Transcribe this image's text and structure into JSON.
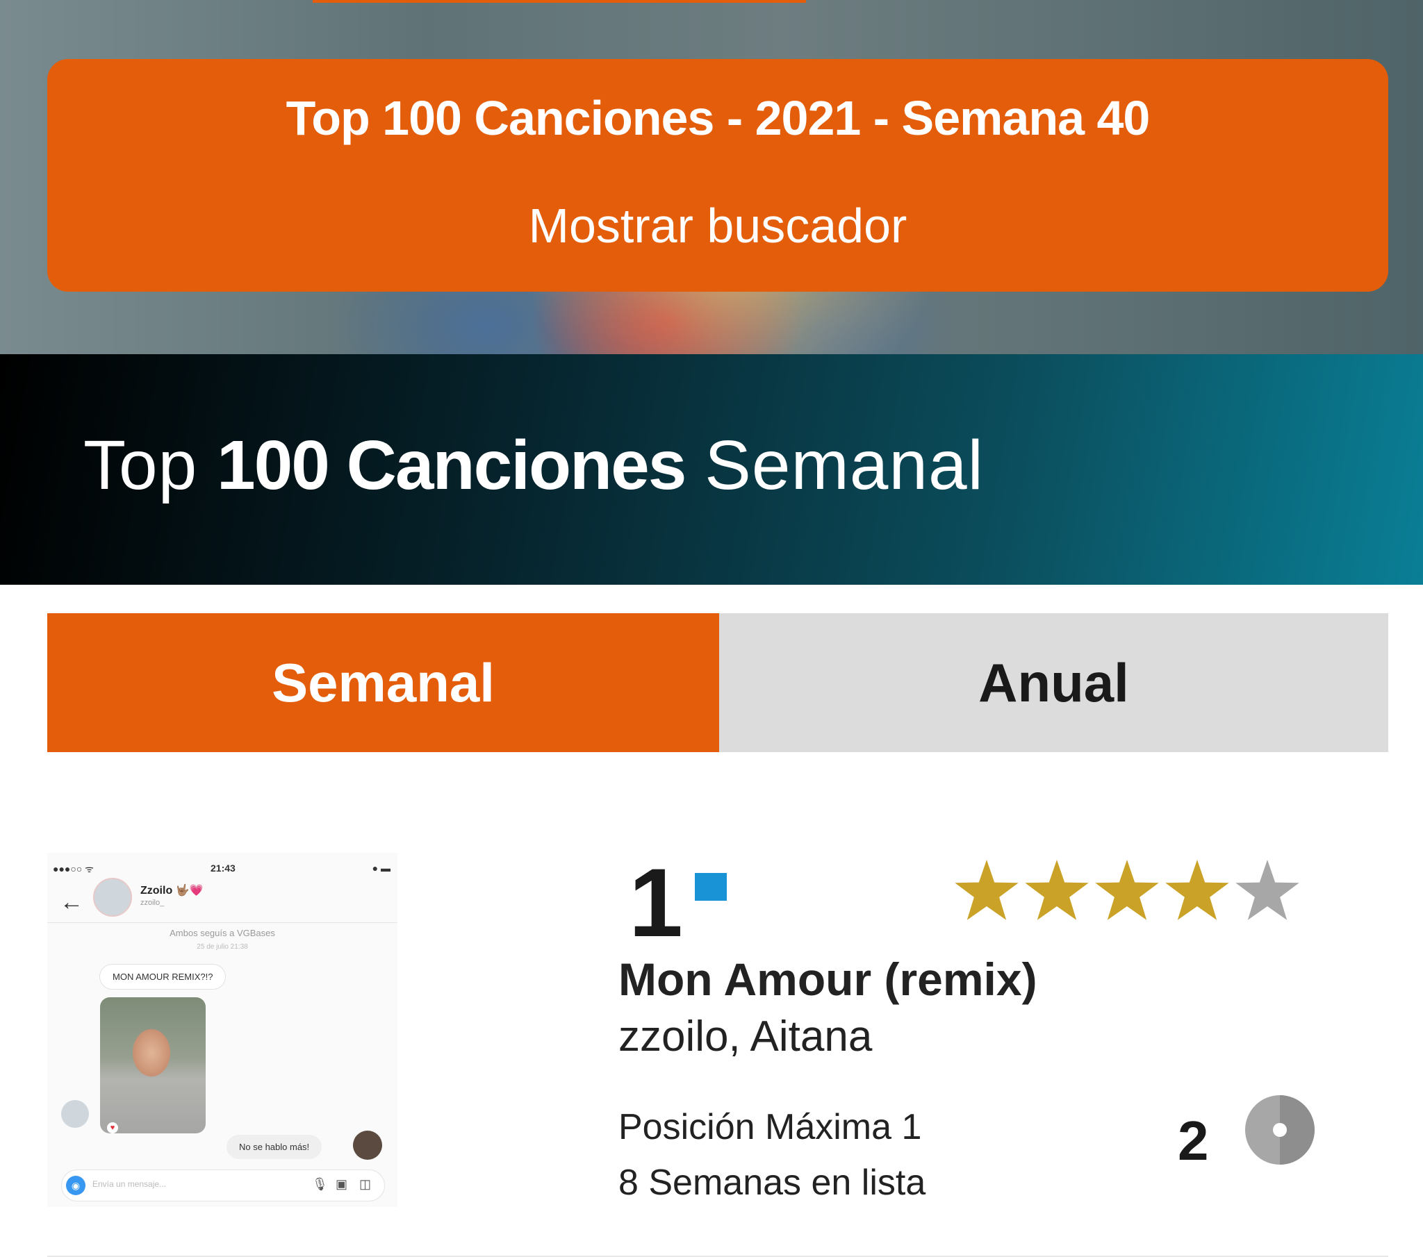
{
  "banner": {
    "title": "Top 100 Canciones - 2021 - Semana 40",
    "search_toggle": "Mostrar buscador"
  },
  "section": {
    "heading_prefix": "Top",
    "heading_bold": "100 Canciones",
    "heading_suffix": "Semanal"
  },
  "tabs": [
    {
      "label": "Semanal",
      "active": true
    },
    {
      "label": "Anual",
      "active": false
    }
  ],
  "entry": {
    "position": "1",
    "trend": "same",
    "rating": 4,
    "rating_max": 5,
    "title": "Mon Amour (remix)",
    "artist": "zzoilo, Aitana",
    "peak_position": "Posición Máxima 1",
    "weeks_on_chart": "8 Semanas en lista",
    "certification_count": "2",
    "certification_icon": "platinum-disc-icon",
    "thumbnail": {
      "status_left": "●●●○○ ᯤ",
      "status_time": "21:43",
      "status_right": "● ▬",
      "contact_name": "Zzoilo 🤟🏽💗",
      "contact_user": "zzoilo_",
      "follow_note": "Ambos seguís a VGBases",
      "date_note": "25 de julio 21:38",
      "message_1": "MON AMOUR REMIX?!?",
      "message_2": "No se hablo más!",
      "input_placeholder": "Envía un mensaje..."
    }
  },
  "colors": {
    "accent": "#e35d0a",
    "tab_inactive": "#dcdcdc",
    "trend_marker": "#1a93d6",
    "star_filled": "#c9a227",
    "star_empty": "#a7a7a7"
  }
}
